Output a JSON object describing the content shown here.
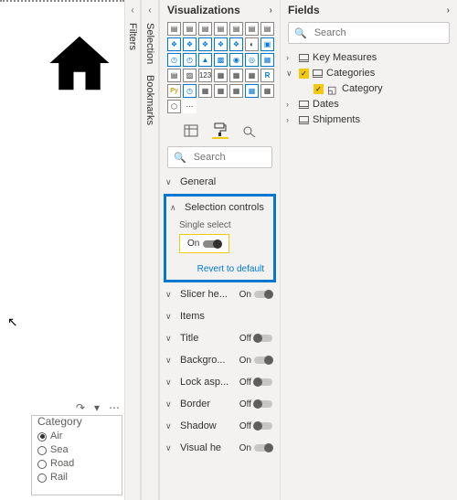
{
  "rails": {
    "filters": "Filters",
    "selection": "Selection",
    "bookmarks": "Bookmarks"
  },
  "viz": {
    "title": "Visualizations",
    "search_placeholder": "Search",
    "general": "General",
    "selection_controls": "Selection controls",
    "single_select": "Single select",
    "single_select_state": "On",
    "revert": "Revert to default",
    "rows": [
      {
        "label": "Slicer he...",
        "state": "On",
        "on": true
      },
      {
        "label": "Items",
        "state": "",
        "on": null
      },
      {
        "label": "Title",
        "state": "Off",
        "on": false
      },
      {
        "label": "Backgro...",
        "state": "On",
        "on": true
      },
      {
        "label": "Lock asp...",
        "state": "Off",
        "on": false
      },
      {
        "label": "Border",
        "state": "Off",
        "on": false
      },
      {
        "label": "Shadow",
        "state": "Off",
        "on": false
      },
      {
        "label": "Visual he",
        "state": "On",
        "on": true
      }
    ]
  },
  "fields": {
    "title": "Fields",
    "search_placeholder": "Search",
    "items": [
      {
        "label": "Key Measures"
      },
      {
        "label": "Categories"
      },
      {
        "label": "Category"
      },
      {
        "label": "Dates"
      },
      {
        "label": "Shipments"
      }
    ]
  },
  "slicer": {
    "title": "Category",
    "options": [
      "Air",
      "Sea",
      "Road",
      "Rail"
    ]
  }
}
